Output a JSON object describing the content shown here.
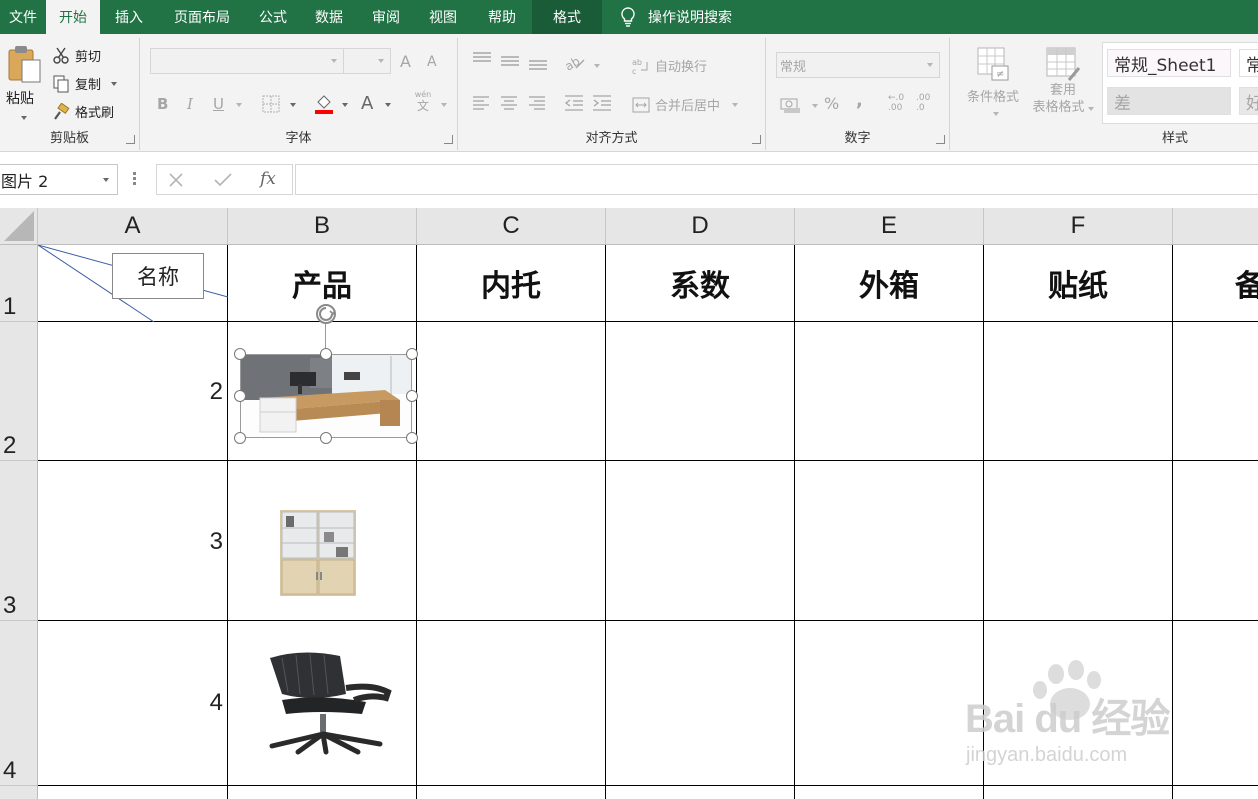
{
  "tabs": [
    "文件",
    "开始",
    "插入",
    "页面布局",
    "公式",
    "数据",
    "审阅",
    "视图",
    "帮助",
    "格式"
  ],
  "active_tab_index": 1,
  "tell_me": "操作说明搜索",
  "clipboard": {
    "paste": "粘贴",
    "cut": "剪切",
    "copy": "复制",
    "format_painter": "格式刷",
    "label": "剪贴板"
  },
  "font": {
    "label": "字体",
    "bold": "B",
    "italic": "I",
    "underline": "U",
    "grow": "A",
    "shrink": "A",
    "color": "A",
    "phonetic": "wén",
    "phonetic_char": "文"
  },
  "alignment": {
    "wrap": "自动换行",
    "merge": "合并后居中",
    "label": "对齐方式"
  },
  "number": {
    "format": "常规",
    "percent": "%",
    "comma": ",",
    "inc_decimal": ".00",
    "dec_decimal": ".0",
    "label": "数字"
  },
  "styles": {
    "conditional": "条件格式",
    "table_format_line1": "套用",
    "table_format_line2": "表格格式",
    "normal_sheet1": "常规_Sheet1",
    "normal": "常",
    "bad": "差",
    "good": "好",
    "label": "样式"
  },
  "name_box": "图片 2",
  "fx": "fx",
  "columns": [
    "A",
    "B",
    "C",
    "D",
    "E",
    "F"
  ],
  "rows": [
    "1",
    "2",
    "3",
    "4"
  ],
  "header_cells": [
    "产品",
    "内托",
    "系数",
    "外箱",
    "贴纸",
    "备"
  ],
  "diagonal_label": "名称",
  "col_a_values": [
    "2",
    "3",
    "4"
  ],
  "watermark": {
    "brand": "Bai  du 经验",
    "url": "jingyan.baidu.com"
  },
  "colors": {
    "accent": "#217346",
    "ribbon_bg": "#f3f3f3",
    "header_bg": "#e6e6e6"
  }
}
